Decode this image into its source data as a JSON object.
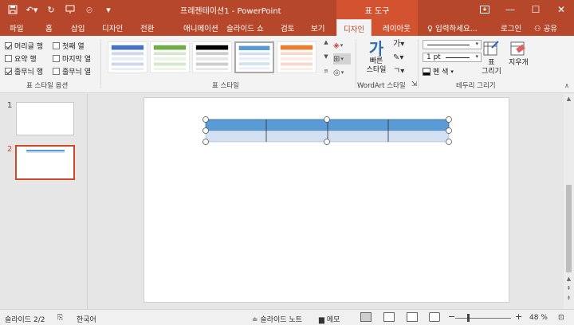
{
  "window": {
    "title": "프레젠테이션1 - PowerPoint",
    "context_tool": "표 도구"
  },
  "tabs": [
    "파일",
    "홈",
    "삽입",
    "디자인",
    "전환",
    "애니메이션",
    "슬라이드 쇼",
    "검토",
    "보기",
    "디자인",
    "레이아웃"
  ],
  "active_tab": "디자인",
  "tell_me": "입력하세요...",
  "sign_in": "로그인",
  "share": "공유",
  "table_style_options": {
    "label": "표 스타일 옵션",
    "items": [
      {
        "label": "머리글 행",
        "checked": true
      },
      {
        "label": "첫째 열",
        "checked": false
      },
      {
        "label": "요약 행",
        "checked": false
      },
      {
        "label": "마지막 열",
        "checked": false
      },
      {
        "label": "줄무늬 행",
        "checked": true
      },
      {
        "label": "줄무늬 열",
        "checked": false
      }
    ]
  },
  "table_styles": {
    "label": "표 스타일",
    "styles": [
      {
        "name": "blue-style",
        "header": "#4472c4",
        "band": "#cfd5ea"
      },
      {
        "name": "green-style",
        "header": "#70ad47",
        "band": "#d5e8cc"
      },
      {
        "name": "black-style",
        "header": "#000000",
        "band": "#cccccc"
      },
      {
        "name": "lightblue-style",
        "header": "#5b9bd5",
        "band": "#d2e0f1",
        "selected": true
      },
      {
        "name": "orange-style",
        "header": "#ed7d31",
        "band": "#f8d9c9"
      }
    ]
  },
  "wordart": {
    "label": "WordArt 스타일",
    "quick_styles_line1": "빠른",
    "quick_styles_line2": "스타일",
    "small_glyph": "가"
  },
  "draw_borders": {
    "label": "테두리 그리기",
    "pen_weight": "1 pt",
    "pen_color": "펜 색",
    "draw_table": "표\n그리기",
    "draw_table_line1": "표",
    "draw_table_line2": "그리기",
    "eraser": "지우개"
  },
  "slides": [
    {
      "number": "1"
    },
    {
      "number": "2",
      "selected": true
    }
  ],
  "table_on_slide": {
    "header_color": "#5b9bd5",
    "row_color": "#d2e0f1",
    "columns": 4
  },
  "statusbar": {
    "slide_info": "슬라이드 2/2",
    "language": "한국어",
    "notes": "슬라이드 노트",
    "comments": "메모",
    "zoom": "48 %"
  }
}
